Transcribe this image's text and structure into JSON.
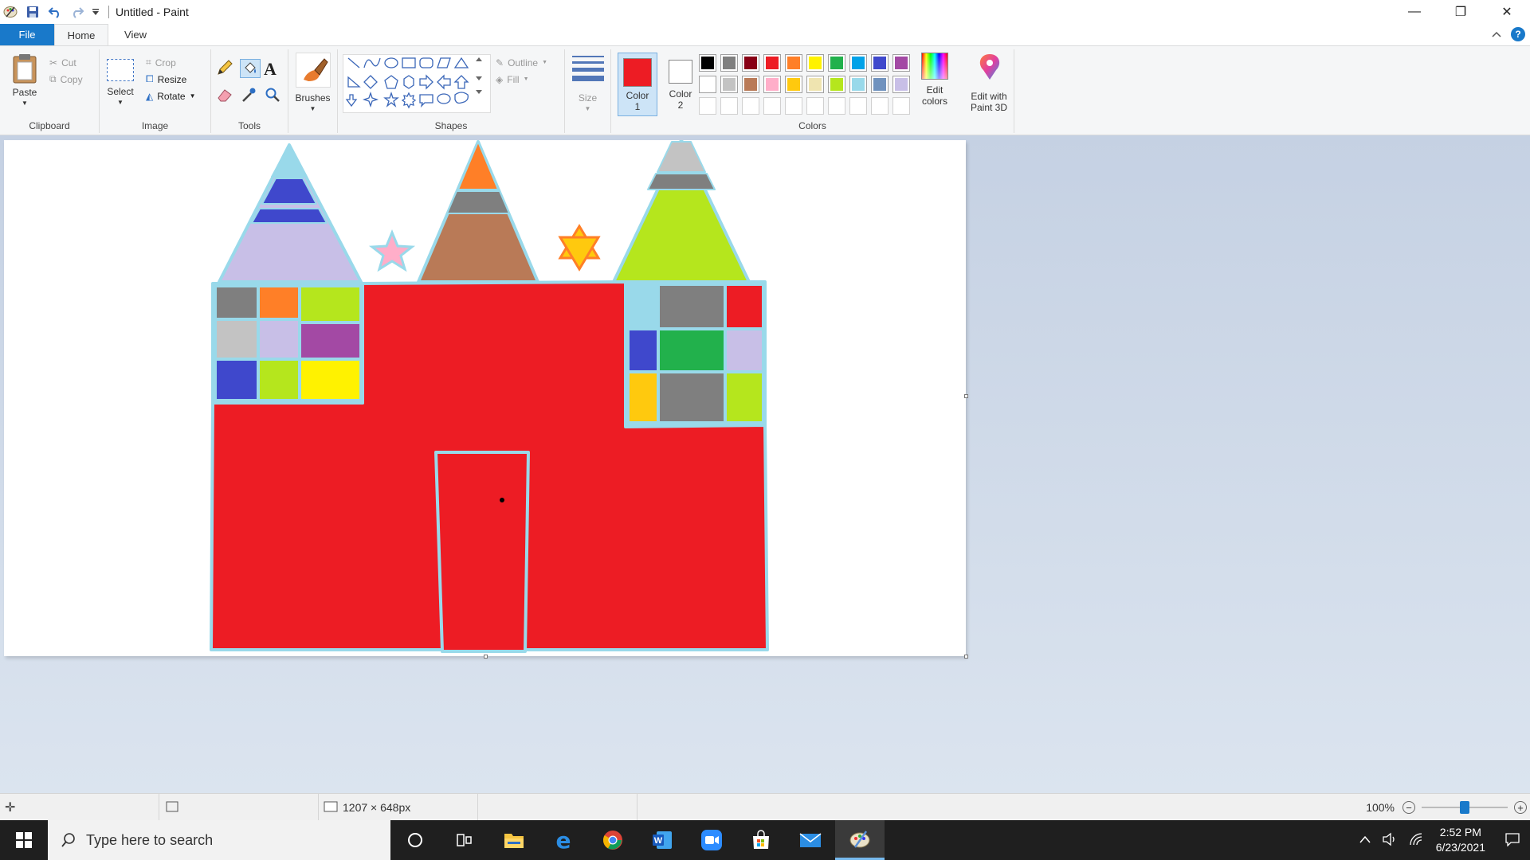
{
  "window": {
    "title": "Untitled - Paint",
    "controls": {
      "minimize": "—",
      "restore": "❐",
      "close": "✕"
    }
  },
  "tabs": {
    "file": "File",
    "home": "Home",
    "view": "View"
  },
  "ribbon": {
    "clipboard": {
      "paste": "Paste",
      "cut": "Cut",
      "copy": "Copy",
      "group": "Clipboard"
    },
    "image": {
      "select": "Select",
      "crop": "Crop",
      "resize": "Resize",
      "rotate": "Rotate",
      "group": "Image"
    },
    "tools": {
      "group": "Tools"
    },
    "brushes": {
      "label": "Brushes"
    },
    "shapes": {
      "outline": "Outline",
      "fill": "Fill",
      "group": "Shapes"
    },
    "size": {
      "label": "Size"
    },
    "colors": {
      "color1": "Color",
      "color1_num": "1",
      "color2": "Color",
      "color2_num": "2",
      "edit": "Edit",
      "edit2": "colors",
      "group": "Colors",
      "color1_value": "#ed1c24",
      "color2_value": "#ffffff",
      "palette_row1": [
        "#000000",
        "#7f7f7f",
        "#880015",
        "#ed1c24",
        "#ff7f27",
        "#fff200",
        "#22b14c",
        "#00a2e8",
        "#3f48cc",
        "#a349a4"
      ],
      "palette_row2": [
        "#ffffff",
        "#c3c3c3",
        "#b97a57",
        "#ffaec9",
        "#ffc90e",
        "#efe4b0",
        "#b5e61d",
        "#99d9ea",
        "#7092be",
        "#c8bfe7"
      ]
    },
    "paint3d": {
      "line1": "Edit with",
      "line2": "Paint 3D"
    }
  },
  "status": {
    "canvas_size": "1207 × 648px",
    "zoom": "100%"
  },
  "taskbar": {
    "search_placeholder": "Type here to search",
    "time": "2:52 PM",
    "date": "6/23/2021"
  }
}
